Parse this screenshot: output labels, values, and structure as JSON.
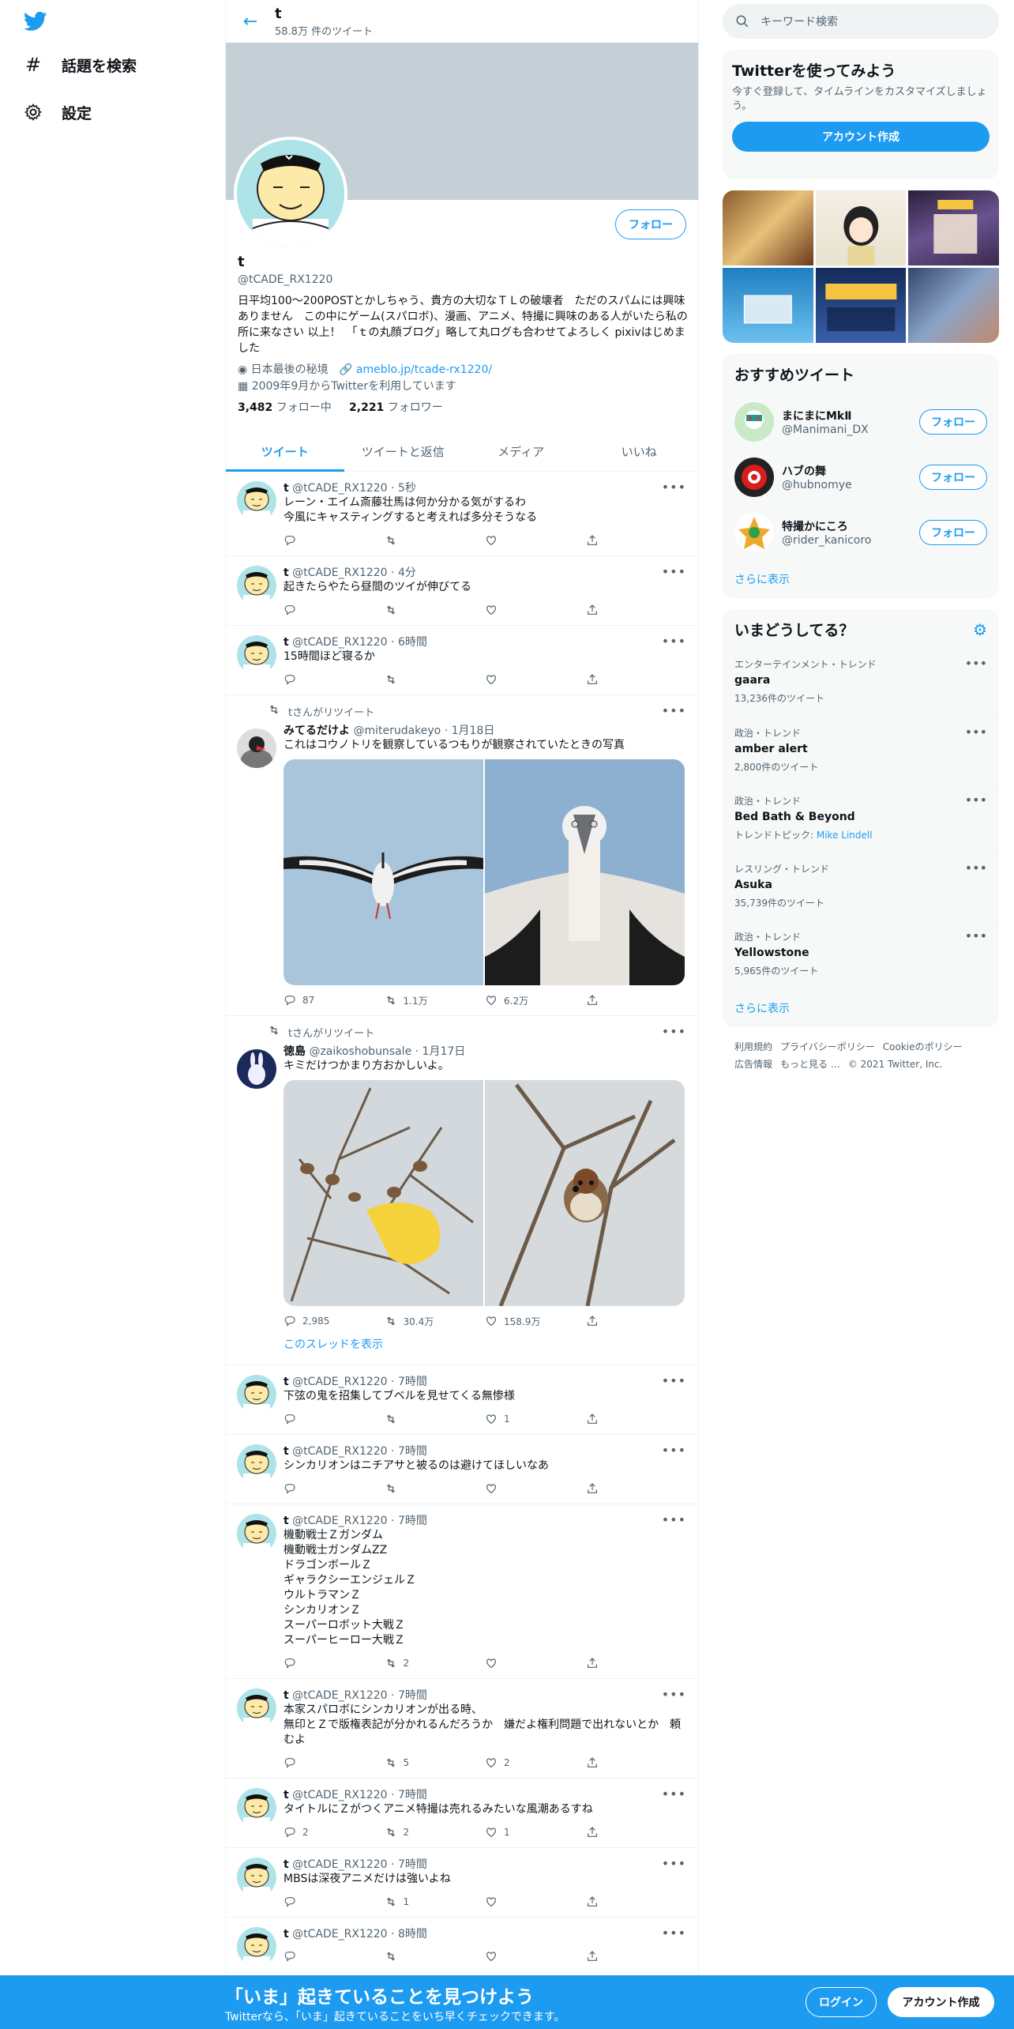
{
  "nav": {
    "explore": "話題を検索",
    "settings": "設定"
  },
  "header": {
    "name": "t",
    "count": "58.8万 件のツイート"
  },
  "profile": {
    "name": "t",
    "handle": "@tCADE_RX1220",
    "follow_label": "フォロー",
    "bio": "日平均100～200POSTとかしちゃう、貴方の大切なＴＬの破壊者　ただのスパムには興味ありません　この中にゲーム(スパロボ)、漫画、アニメ、特撮に興味のある人がいたら私の所に来なさい 以上！　「ｔの丸顔ブログ」略して丸ログも合わせてよろしく pixivはじめました",
    "location": "日本最後の秘境",
    "link": "ameblo.jp/tcade-rx1220/",
    "joined": "2009年9月からTwitterを利用しています",
    "following_count": "3,482",
    "following_label": "フォロー中",
    "followers_count": "2,221",
    "followers_label": "フォロワー"
  },
  "tabs": [
    "ツイート",
    "ツイートと返信",
    "メディア",
    "いいね"
  ],
  "tweets": [
    {
      "name": "t",
      "handle": "@tCADE_RX1220",
      "time": "5秒",
      "text": "レーン・エイム斎藤壮馬は何か分かる気がするわ\n今風にキャスティングすると考えれば多分そうなる",
      "reply": "",
      "rt": "",
      "like": ""
    },
    {
      "name": "t",
      "handle": "@tCADE_RX1220",
      "time": "4分",
      "text": "起きたらやたら昼間のツイが伸びてる",
      "reply": "",
      "rt": "",
      "like": ""
    },
    {
      "name": "t",
      "handle": "@tCADE_RX1220",
      "time": "6時間",
      "text": "15時間ほど寝るか",
      "reply": "",
      "rt": "",
      "like": ""
    },
    {
      "retweet_label": "tさんがリツイート",
      "name": "みてるだけよ",
      "handle": "@miterudakeyo",
      "time": "1月18日",
      "text": "これはコウノトリを観察しているつもりが観察されていたときの写真",
      "reply": "87",
      "rt": "1.1万",
      "like": "6.2万"
    },
    {
      "retweet_label": "tさんがリツイート",
      "name": "徳島",
      "handle": "@zaikoshobunsale",
      "time": "1月17日",
      "text": "キミだけつかまり方おかしいよ。",
      "reply": "2,985",
      "rt": "30.4万",
      "like": "158.9万",
      "thread_label": "このスレッドを表示"
    },
    {
      "name": "t",
      "handle": "@tCADE_RX1220",
      "time": "7時間",
      "text": "下弦の鬼を招集してブベルを見せてくる無惨様",
      "reply": "",
      "rt": "",
      "like": "1"
    },
    {
      "name": "t",
      "handle": "@tCADE_RX1220",
      "time": "7時間",
      "text": "シンカリオンはニチアサと被るのは避けてほしいなあ",
      "reply": "",
      "rt": "",
      "like": ""
    },
    {
      "name": "t",
      "handle": "@tCADE_RX1220",
      "time": "7時間",
      "text": "機動戦士Ｚガンダム\n機動戦士ガンダムZZ\nドラゴンボールＺ\nギャラクシーエンジェルＺ\nウルトラマンＺ\nシンカリオンＺ\nスーパーロボット大戦Ｚ\nスーパーヒーロー大戦Ｚ",
      "reply": "",
      "rt": "2",
      "like": ""
    },
    {
      "name": "t",
      "handle": "@tCADE_RX1220",
      "time": "7時間",
      "text": "本家スパロボにシンカリオンが出る時、\n無印とＺで版権表記が分かれるんだろうか　嫌だよ権利問題で出れないとか　頼むよ",
      "reply": "",
      "rt": "5",
      "like": "2"
    },
    {
      "name": "t",
      "handle": "@tCADE_RX1220",
      "time": "7時間",
      "text": "タイトルにＺがつくアニメ特撮は売れるみたいな風潮あるすね",
      "reply": "2",
      "rt": "2",
      "like": "1"
    },
    {
      "name": "t",
      "handle": "@tCADE_RX1220",
      "time": "7時間",
      "text": "MBSは深夜アニメだけは強いよね",
      "reply": "",
      "rt": "1",
      "like": ""
    },
    {
      "name": "t",
      "handle": "@tCADE_RX1220",
      "time": "8時間",
      "text": "",
      "reply": "",
      "rt": "",
      "like": ""
    }
  ],
  "right": {
    "search_placeholder": "キーワード検索",
    "signup_title": "Twitterを使ってみよう",
    "signup_text": "今すぐ登録して、タイムラインをカスタマイズしましょう。",
    "signup_button": "アカウント作成",
    "suggest_title": "おすすめツイート",
    "suggestions": [
      {
        "name": "まにまにMkⅡ",
        "handle": "@Manimani_DX",
        "button": "フォロー"
      },
      {
        "name": "ハブの舞",
        "handle": "@hubnomye",
        "button": "フォロー"
      },
      {
        "name": "特撮かにころ",
        "handle": "@rider_kanicoro",
        "button": "フォロー"
      }
    ],
    "show_more": "さらに表示",
    "trends_title": "いまどうしてる？",
    "trends": [
      {
        "category": "エンターテインメント・トレンド",
        "name": "gaara",
        "count": "13,236件のツイート",
        "topic_prefix": "",
        "topic": ""
      },
      {
        "category": "政治・トレンド",
        "name": "amber alert",
        "count": "2,800件のツイート",
        "topic_prefix": "",
        "topic": ""
      },
      {
        "category": "政治・トレンド",
        "name": "Bed Bath & Beyond",
        "count": "",
        "topic_prefix": "トレンドトピック: ",
        "topic": "Mike Lindell"
      },
      {
        "category": "レスリング・トレンド",
        "name": "Asuka",
        "count": "35,739件のツイート",
        "topic_prefix": "",
        "topic": ""
      },
      {
        "category": "政治・トレンド",
        "name": "Yellowstone",
        "count": "5,965件のツイート",
        "topic_prefix": "",
        "topic": ""
      }
    ],
    "footer": [
      "利用規約",
      "プライバシーポリシー",
      "Cookieのポリシー",
      "広告情報",
      "もっと見る …",
      "© 2021 Twitter, Inc."
    ]
  },
  "bottom": {
    "title": "「いま」起きていることを見つけよう",
    "subtitle": "Twitterなら、「いま」起きていることをいち早くチェックできます。",
    "login": "ログイン",
    "signup": "アカウント作成"
  },
  "colors": {
    "accent": "#1d9bf0",
    "banner": "#c4cfd6",
    "text_secondary": "#536471"
  }
}
